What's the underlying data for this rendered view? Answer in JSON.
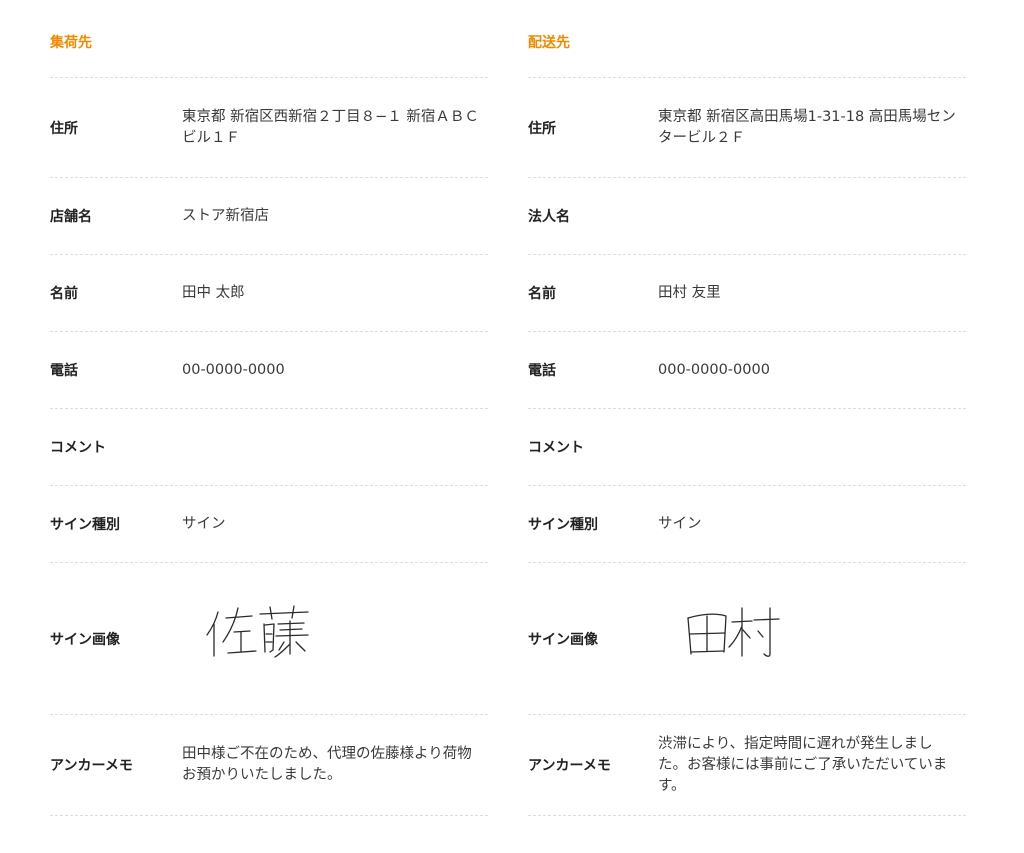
{
  "accent_color": "#f08a00",
  "pickup": {
    "title": "集荷先",
    "address": {
      "label": "住所",
      "value": "東京都 新宿区西新宿２丁目８−１ 新宿ＡＢＣビル１Ｆ"
    },
    "store": {
      "label": "店舗名",
      "value": "ストア新宿店"
    },
    "name": {
      "label": "名前",
      "value": "田中 太郎"
    },
    "phone": {
      "label": "電話",
      "value": "00-0000-0000"
    },
    "comment": {
      "label": "コメント",
      "value": ""
    },
    "sign_type": {
      "label": "サイン種別",
      "value": "サイン"
    },
    "sign_image": {
      "label": "サイン画像",
      "signature_text": "佐藤"
    },
    "memo": {
      "label": "アンカーメモ",
      "value": "田中様ご不在のため、代理の佐藤様より荷物お預かりいたしました。"
    }
  },
  "delivery": {
    "title": "配送先",
    "address": {
      "label": "住所",
      "value": "東京都 新宿区高田馬場1-31-18 高田馬場センタービル２Ｆ"
    },
    "company": {
      "label": "法人名",
      "value": ""
    },
    "name": {
      "label": "名前",
      "value": "田村 友里"
    },
    "phone": {
      "label": "電話",
      "value": "000-0000-0000"
    },
    "comment": {
      "label": "コメント",
      "value": ""
    },
    "sign_type": {
      "label": "サイン種別",
      "value": "サイン"
    },
    "sign_image": {
      "label": "サイン画像",
      "signature_text": "田村"
    },
    "memo": {
      "label": "アンカーメモ",
      "value": "渋滞により、指定時間に遅れが発生しました。お客様には事前にご了承いただいています。"
    }
  }
}
